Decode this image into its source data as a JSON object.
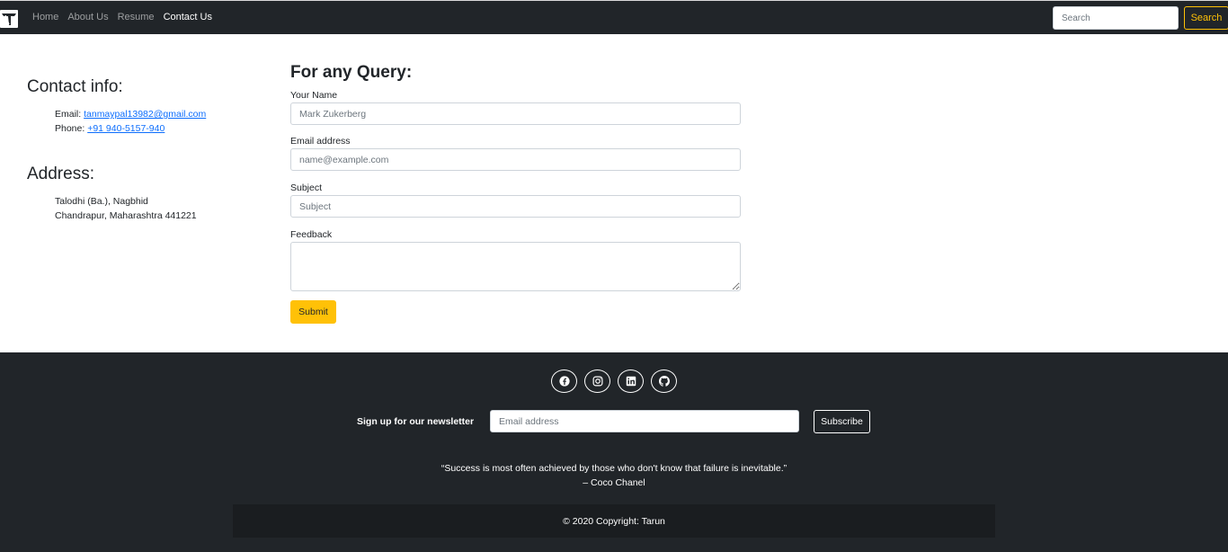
{
  "navbar": {
    "links": [
      {
        "label": "Home",
        "active": false
      },
      {
        "label": "About Us",
        "active": false
      },
      {
        "label": "Resume",
        "active": false
      },
      {
        "label": "Contact Us",
        "active": true
      }
    ],
    "search_placeholder": "Search",
    "search_button": "Search"
  },
  "contact_info": {
    "title": "Contact info:",
    "email_label": "Email: ",
    "email": "tanmaypal13982@gmail.com",
    "phone_label": "Phone: ",
    "phone": "+91 940-5157-940"
  },
  "address": {
    "title": "Address:",
    "line1": "Talodhi (Ba.), Nagbhid",
    "line2": "Chandrapur, Maharashtra 441221"
  },
  "form": {
    "title": "For any Query:",
    "name_label": "Your Name",
    "name_placeholder": "Mark Zukerberg",
    "email_label": "Email address",
    "email_placeholder": "name@example.com",
    "subject_label": "Subject",
    "subject_placeholder": "Subject",
    "feedback_label": "Feedback",
    "submit_label": "Submit"
  },
  "footer": {
    "social_icons": [
      "facebook-icon",
      "instagram-icon",
      "linkedin-icon",
      "github-icon"
    ],
    "newsletter_label": "Sign up for our newsletter",
    "newsletter_placeholder": "Email address",
    "subscribe_label": "Subscribe",
    "quote": "“Success is most often achieved by those who don't know that failure is inevitable.”",
    "quote_author": "– Coco Chanel",
    "copyright": "© 2020 Copyright: Tarun"
  },
  "colors": {
    "dark": "#212529",
    "accent": "#ffc107",
    "link": "#0d6efd"
  }
}
